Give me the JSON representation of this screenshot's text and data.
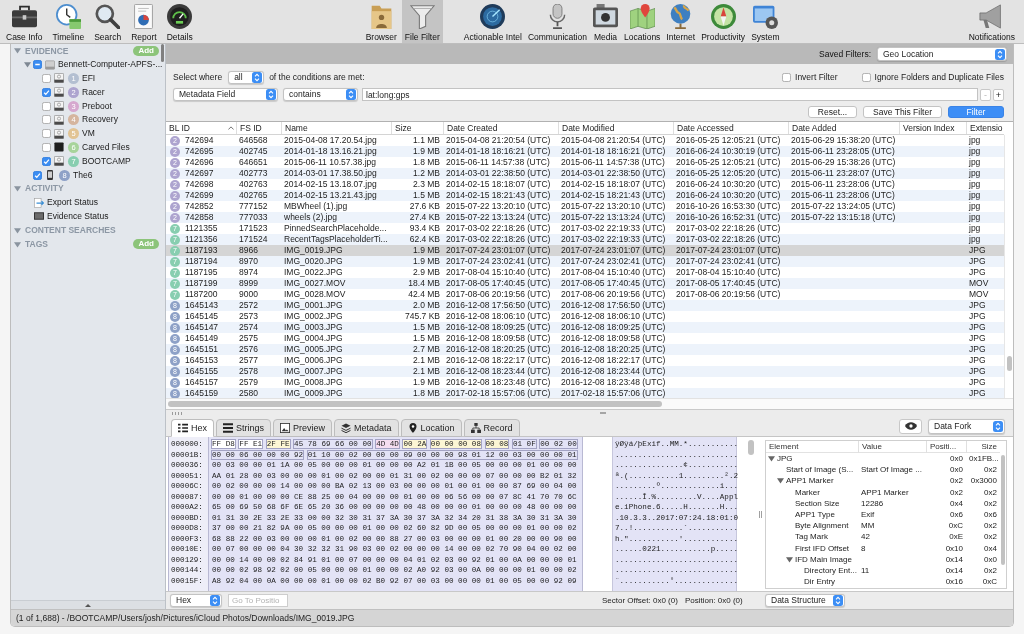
{
  "toolbar": {
    "tools": [
      {
        "label": "Case Info"
      },
      {
        "label": "Timeline"
      },
      {
        "label": "Search"
      },
      {
        "label": "Report"
      },
      {
        "label": "Details"
      }
    ],
    "views": [
      {
        "label": "Browser",
        "selected": false
      },
      {
        "label": "File Filter",
        "selected": true
      }
    ],
    "artifacts": [
      {
        "label": "Actionable Intel"
      },
      {
        "label": "Communication"
      },
      {
        "label": "Media"
      },
      {
        "label": "Locations"
      },
      {
        "label": "Internet"
      },
      {
        "label": "Productivity"
      },
      {
        "label": "System"
      }
    ],
    "notifications": {
      "label": "Notifications"
    }
  },
  "sidebar": {
    "sections": [
      {
        "title": "EVIDENCE",
        "expanded": true,
        "add_button": "Add",
        "items": [
          {
            "label": "Bennett-Computer-APFS-...",
            "kind": "disk",
            "checked": true,
            "mixed": true,
            "expanded": true,
            "children": [
              {
                "label": "EFI",
                "kind": "volume",
                "badge": "1",
                "color": "#b3bfd1",
                "checked": false
              },
              {
                "label": "Racer",
                "kind": "volume",
                "badge": "2",
                "color": "#ada4cf",
                "checked": true
              },
              {
                "label": "Preboot",
                "kind": "volume",
                "badge": "3",
                "color": "#d6a8cf",
                "checked": false
              },
              {
                "label": "Recovery",
                "kind": "volume",
                "badge": "4",
                "color": "#d5b59e",
                "checked": false
              },
              {
                "label": "VM",
                "kind": "volume",
                "badge": "5",
                "color": "#e2c494",
                "checked": false
              },
              {
                "label": "Carved Files",
                "kind": "carved",
                "badge": "6",
                "color": "#a8d49b",
                "checked": false
              },
              {
                "label": "BOOTCAMP",
                "kind": "volume",
                "badge": "7",
                "color": "#88ceb0",
                "checked": true
              }
            ]
          },
          {
            "label": "The6",
            "kind": "phone",
            "badge": "8",
            "color": "#8ea1c7",
            "checked": true,
            "mixed": false
          }
        ]
      },
      {
        "title": "ACTIVITY",
        "expanded": true,
        "items": [
          {
            "label": "Export Status",
            "kind": "export"
          },
          {
            "label": "Evidence Status",
            "kind": "status"
          }
        ]
      },
      {
        "title": "CONTENT SEARCHES",
        "expanded": true
      },
      {
        "title": "TAGS",
        "expanded": true,
        "add_button": "Add"
      }
    ]
  },
  "filter": {
    "saved_label": "Saved Filters:",
    "saved_value": "Geo Location",
    "select_where": "Select where",
    "match": "all",
    "conditions_text": "of the conditions are met:",
    "options": [
      {
        "label": "Invert Filter",
        "checked": false
      },
      {
        "label": "Ignore Folders and Duplicate Files",
        "checked": false
      }
    ],
    "condition": {
      "field": "Metadata Field",
      "operator": "contains",
      "value": "lat:long:gps",
      "remove": {
        "label": "-",
        "disabled": true
      },
      "add": {
        "label": "+",
        "disabled": false
      }
    },
    "buttons": [
      {
        "label": "Reset...",
        "kind": "secondary"
      },
      {
        "label": "Save This Filter",
        "kind": "secondary"
      },
      {
        "label": "Filter",
        "kind": "primary"
      }
    ]
  },
  "table": {
    "columns": [
      {
        "label": "BL ID",
        "sorted": true
      },
      {
        "label": "FS ID",
        "sorted": false
      },
      {
        "label": "Name",
        "sorted": false
      },
      {
        "label": "Size",
        "sorted": false
      },
      {
        "label": "Date Created",
        "sorted": false
      },
      {
        "label": "Date Modified",
        "sorted": false
      },
      {
        "label": "Date Accessed",
        "sorted": false
      },
      {
        "label": "Date Added",
        "sorted": false
      },
      {
        "label": "Version Index",
        "sorted": false
      },
      {
        "label": "Extensio",
        "sorted": false
      }
    ],
    "rows": [
      {
        "badge": "2",
        "color": "#ada4cf",
        "bl_id": "742694",
        "fs_id": "646568",
        "name": "2015-04-08 17.20.54.jpg",
        "size": "1.1 MB",
        "created": "2015-04-08 21:20:54 (UTC)",
        "modified": "2015-04-08 21:20:54 (UTC)",
        "accessed": "2016-05-25 12:05:21 (UTC)",
        "added": "2015-06-29 15:38:20 (UTC)",
        "extension": "jpg",
        "selected": false
      },
      {
        "badge": "2",
        "color": "#ada4cf",
        "bl_id": "742695",
        "fs_id": "402745",
        "name": "2014-01-18 13.16.21.jpg",
        "size": "1.9 MB",
        "created": "2014-01-18 18:16:21 (UTC)",
        "modified": "2014-01-18 18:16:21 (UTC)",
        "accessed": "2016-06-24 10:30:19 (UTC)",
        "added": "2015-06-11 23:28:05 (UTC)",
        "extension": "jpg",
        "selected": false
      },
      {
        "badge": "2",
        "color": "#ada4cf",
        "bl_id": "742696",
        "fs_id": "646651",
        "name": "2015-06-11 10.57.38.jpg",
        "size": "1.8 MB",
        "created": "2015-06-11 14:57:38 (UTC)",
        "modified": "2015-06-11 14:57:38 (UTC)",
        "accessed": "2016-05-25 12:05:21 (UTC)",
        "added": "2015-06-29 15:38:26 (UTC)",
        "extension": "jpg",
        "selected": false
      },
      {
        "badge": "2",
        "color": "#ada4cf",
        "bl_id": "742697",
        "fs_id": "402773",
        "name": "2014-03-01 17.38.50.jpg",
        "size": "1.2 MB",
        "created": "2014-03-01 22:38:50 (UTC)",
        "modified": "2014-03-01 22:38:50 (UTC)",
        "accessed": "2016-05-25 12:05:20 (UTC)",
        "added": "2015-06-11 23:28:07 (UTC)",
        "extension": "jpg",
        "selected": false
      },
      {
        "badge": "2",
        "color": "#ada4cf",
        "bl_id": "742698",
        "fs_id": "402763",
        "name": "2014-02-15 13.18.07.jpg",
        "size": "2.3 MB",
        "created": "2014-02-15 18:18:07 (UTC)",
        "modified": "2014-02-15 18:18:07 (UTC)",
        "accessed": "2016-06-24 10:30:20 (UTC)",
        "added": "2015-06-11 23:28:06 (UTC)",
        "extension": "jpg",
        "selected": false
      },
      {
        "badge": "2",
        "color": "#ada4cf",
        "bl_id": "742699",
        "fs_id": "402765",
        "name": "2014-02-15 13.21.43.jpg",
        "size": "1.5 MB",
        "created": "2014-02-15 18:21:43 (UTC)",
        "modified": "2014-02-15 18:21:43 (UTC)",
        "accessed": "2016-06-24 10:30:20 (UTC)",
        "added": "2015-06-11 23:28:06 (UTC)",
        "extension": "jpg",
        "selected": false
      },
      {
        "badge": "2",
        "color": "#ada4cf",
        "bl_id": "742852",
        "fs_id": "777152",
        "name": "MBWheel (1).jpg",
        "size": "27.6 KB",
        "created": "2015-07-22 13:20:10 (UTC)",
        "modified": "2015-07-22 13:20:10 (UTC)",
        "accessed": "2016-10-26 16:53:30 (UTC)",
        "added": "2015-07-22 13:24:05 (UTC)",
        "extension": "jpg",
        "selected": false
      },
      {
        "badge": "2",
        "color": "#ada4cf",
        "bl_id": "742858",
        "fs_id": "777033",
        "name": "wheels (2).jpg",
        "size": "27.4 KB",
        "created": "2015-07-22 13:13:24 (UTC)",
        "modified": "2015-07-22 13:13:24 (UTC)",
        "accessed": "2016-10-26 16:52:31 (UTC)",
        "added": "2015-07-22 13:15:18 (UTC)",
        "extension": "jpg",
        "selected": false
      },
      {
        "badge": "7",
        "color": "#88ceb0",
        "bl_id": "1121355",
        "fs_id": "171523",
        "name": "PinnedSearchPlaceholde...",
        "size": "93.4 KB",
        "created": "2017-03-02 22:18:26 (UTC)",
        "modified": "2017-03-02 22:19:33 (UTC)",
        "accessed": "2017-03-02 22:18:26 (UTC)",
        "extension": "jpg",
        "selected": false
      },
      {
        "badge": "7",
        "color": "#88ceb0",
        "bl_id": "1121356",
        "fs_id": "171524",
        "name": "RecentTagsPlaceholderTi...",
        "size": "62.4 KB",
        "created": "2017-03-02 22:18:26 (UTC)",
        "modified": "2017-03-02 22:19:33 (UTC)",
        "accessed": "2017-03-02 22:18:26 (UTC)",
        "extension": "jpg",
        "selected": false
      },
      {
        "badge": "7",
        "color": "#88ceb0",
        "bl_id": "1187193",
        "fs_id": "8966",
        "name": "IMG_0019.JPG",
        "size": "1.9 MB",
        "created": "2017-07-24 23:01:07 (UTC)",
        "modified": "2017-07-24 23:01:07 (UTC)",
        "accessed": "2017-07-24 23:01:07 (UTC)",
        "extension": "JPG",
        "selected": true
      },
      {
        "badge": "7",
        "color": "#88ceb0",
        "bl_id": "1187194",
        "fs_id": "8970",
        "name": "IMG_0020.JPG",
        "size": "1.9 MB",
        "created": "2017-07-24 23:02:41 (UTC)",
        "modified": "2017-07-24 23:02:41 (UTC)",
        "accessed": "2017-07-24 23:02:41 (UTC)",
        "extension": "JPG",
        "selected": false
      },
      {
        "badge": "7",
        "color": "#88ceb0",
        "bl_id": "1187195",
        "fs_id": "8974",
        "name": "IMG_0022.JPG",
        "size": "2.9 MB",
        "created": "2017-08-04 15:10:40 (UTC)",
        "modified": "2017-08-04 15:10:40 (UTC)",
        "accessed": "2017-08-04 15:10:40 (UTC)",
        "extension": "JPG",
        "selected": false
      },
      {
        "badge": "7",
        "color": "#88ceb0",
        "bl_id": "1187199",
        "fs_id": "8999",
        "name": "IMG_0027.MOV",
        "size": "18.4 MB",
        "created": "2017-08-05 17:40:45 (UTC)",
        "modified": "2017-08-05 17:40:45 (UTC)",
        "accessed": "2017-08-05 17:40:45 (UTC)",
        "extension": "MOV",
        "selected": false
      },
      {
        "badge": "7",
        "color": "#88ceb0",
        "bl_id": "1187200",
        "fs_id": "9000",
        "name": "IMG_0028.MOV",
        "size": "42.4 MB",
        "created": "2017-08-06 20:19:56 (UTC)",
        "modified": "2017-08-06 20:19:56 (UTC)",
        "accessed": "2017-08-06 20:19:56 (UTC)",
        "extension": "MOV",
        "selected": false
      },
      {
        "badge": "8",
        "color": "#8ea1c7",
        "bl_id": "1645143",
        "fs_id": "2572",
        "name": "IMG_0001.JPG",
        "size": "2.0 MB",
        "created": "2016-12-08 17:56:50 (UTC)",
        "modified": "2016-12-08 17:56:50 (UTC)",
        "extension": "JPG",
        "selected": false
      },
      {
        "badge": "8",
        "color": "#8ea1c7",
        "bl_id": "1645145",
        "fs_id": "2573",
        "name": "IMG_0002.JPG",
        "size": "745.7 KB",
        "created": "2016-12-08 18:06:10 (UTC)",
        "modified": "2016-12-08 18:06:10 (UTC)",
        "extension": "JPG",
        "selected": false
      },
      {
        "badge": "8",
        "color": "#8ea1c7",
        "bl_id": "1645147",
        "fs_id": "2574",
        "name": "IMG_0003.JPG",
        "size": "1.5 MB",
        "created": "2016-12-08 18:09:25 (UTC)",
        "modified": "2016-12-08 18:09:25 (UTC)",
        "extension": "JPG",
        "selected": false
      },
      {
        "badge": "8",
        "color": "#8ea1c7",
        "bl_id": "1645149",
        "fs_id": "2575",
        "name": "IMG_0004.JPG",
        "size": "1.5 MB",
        "created": "2016-12-08 18:09:58 (UTC)",
        "modified": "2016-12-08 18:09:58 (UTC)",
        "extension": "JPG",
        "selected": false
      },
      {
        "badge": "8",
        "color": "#8ea1c7",
        "bl_id": "1645151",
        "fs_id": "2576",
        "name": "IMG_0005.JPG",
        "size": "2.7 MB",
        "created": "2016-12-08 18:20:25 (UTC)",
        "modified": "2016-12-08 18:20:25 (UTC)",
        "extension": "JPG",
        "selected": false
      },
      {
        "badge": "8",
        "color": "#8ea1c7",
        "bl_id": "1645153",
        "fs_id": "2577",
        "name": "IMG_0006.JPG",
        "size": "2.1 MB",
        "created": "2016-12-08 18:22:17 (UTC)",
        "modified": "2016-12-08 18:22:17 (UTC)",
        "extension": "JPG",
        "selected": false
      },
      {
        "badge": "8",
        "color": "#8ea1c7",
        "bl_id": "1645155",
        "fs_id": "2578",
        "name": "IMG_0007.JPG",
        "size": "2.1 MB",
        "created": "2016-12-08 18:23:44 (UTC)",
        "modified": "2016-12-08 18:23:44 (UTC)",
        "extension": "JPG",
        "selected": false
      },
      {
        "badge": "8",
        "color": "#8ea1c7",
        "bl_id": "1645157",
        "fs_id": "2579",
        "name": "IMG_0008.JPG",
        "size": "1.9 MB",
        "created": "2016-12-08 18:23:48 (UTC)",
        "modified": "2016-12-08 18:23:48 (UTC)",
        "extension": "JPG",
        "selected": false
      },
      {
        "badge": "8",
        "color": "#8ea1c7",
        "bl_id": "1645159",
        "fs_id": "2580",
        "name": "IMG_0009.JPG",
        "size": "1.8 MB",
        "created": "2017-02-18 15:57:06 (UTC)",
        "modified": "2017-02-18 15:57:06 (UTC)",
        "extension": "JPG",
        "selected": false
      }
    ]
  },
  "inspector": {
    "tabs": [
      {
        "label": "Hex",
        "selected": true
      },
      {
        "label": "Strings",
        "selected": false
      },
      {
        "label": "Preview",
        "selected": false
      },
      {
        "label": "Metadata",
        "selected": false
      },
      {
        "label": "Location",
        "selected": false
      },
      {
        "label": "Record",
        "selected": false
      }
    ],
    "fork": "Data Fork",
    "hex": {
      "rows": [
        {
          "offset": "000000:",
          "groups": [
            {
              "bytes": "FF D8",
              "color": "#ffffff"
            },
            {
              "bytes": "FF E1",
              "color": "#ffffff"
            },
            {
              "bytes": "2F FE",
              "color": "#fcf6d4"
            },
            {
              "bytes": "45 78 69 66 00 00"
            },
            {
              "bytes": "4D 4D",
              "color": "#f5ddf0"
            },
            {
              "bytes": "00 2A",
              "color": "#fcf6d4"
            },
            {
              "bytes": "00 00 00 08",
              "color": "#fcf6d4"
            },
            {
              "bytes": "00 08",
              "color": "#fcf6d4"
            },
            {
              "bytes": "01 0F"
            },
            {
              "bytes": "00 02 00"
            }
          ],
          "ascii": "ÿØÿá/þExif..MM.*..........."
        },
        {
          "offset": "00001B:",
          "groups": [
            {
              "bytes": "00 00 06 00 00 00 92"
            },
            {
              "bytes": "01 10 00 02 00 00 00 09 00 00 00 98 01 12 00 03 00 00 00 01"
            }
          ],
          "ascii": "..........................."
        },
        {
          "offset": "000036:",
          "bytes": "00 03 00 00 01 1A 00 05 00 00 00 01 00 00 00 A2 01 1B 00 05 00 00 00 01 00 00 00",
          "ascii": "...............¢..........."
        },
        {
          "offset": "000051:",
          "bytes": "AA 01 28 00 03 00 00 00 01 00 02 00 00 01 31 00 02 00 00 00 07 00 00 00 B2 01 32",
          "ascii": "ª.(...........1.........².2"
        },
        {
          "offset": "00006C:",
          "bytes": "00 02 00 00 00 14 00 00 00 BA 02 13 00 03 00 00 00 01 00 01 00 00 87 69 00 04 00",
          "ascii": ".........º.............i..."
        },
        {
          "offset": "000087:",
          "bytes": "00 00 01 00 00 00 CE 88 25 00 04 00 00 00 01 00 00 06 56 00 00 07 8C 41 70 70 6C",
          "ascii": "......Î.%.........V....Appl"
        },
        {
          "offset": "0000A2:",
          "bytes": "65 00 69 50 68 6F 6E 65 20 36 00 00 00 00 00 48 00 00 00 01 00 00 00 48 00 00 00",
          "ascii": "e.iPhone.6.....H.......H..."
        },
        {
          "offset": "0000BD:",
          "bytes": "01 31 30 2E 33 2E 33 00 00 32 30 31 37 3A 30 37 3A 32 34 20 31 38 3A 30 31 3A 30",
          "ascii": ".10.3.3..2017:07:24.18:01:0"
        },
        {
          "offset": "0000D8:",
          "bytes": "37 00 00 21 82 9A 00 05 00 00 00 01 00 00 02 60 82 9D 00 05 00 00 00 01 00 00 02",
          "ascii": "7..!...........`..........."
        },
        {
          "offset": "0000F3:",
          "bytes": "68 88 22 00 03 00 00 00 01 00 02 00 00 88 27 00 03 00 00 00 01 00 20 00 00 90 00",
          "ascii": "h.\"...........'............"
        },
        {
          "offset": "00010E:",
          "bytes": "00 07 00 00 00 04 30 32 32 31 90 03 00 02 00 00 00 14 00 00 02 70 90 04 00 02 00",
          "ascii": "......0221...........p....."
        },
        {
          "offset": "000129:",
          "bytes": "00 00 14 00 00 02 84 91 01 00 07 00 00 00 04 01 02 03 00 92 01 00 0A 00 00 00 01",
          "ascii": "..........................."
        },
        {
          "offset": "000144:",
          "bytes": "00 00 02 98 92 02 00 05 00 00 00 01 00 00 02 A0 92 03 00 0A 00 00 00 01 00 00 02",
          "ascii": "..........................."
        },
        {
          "offset": "00015F:",
          "bytes": "A8 92 04 00 0A 00 00 00 01 00 00 02 B0 92 07 00 03 00 00 00 01 00 05 00 00 92 09",
          "ascii": "¨...........°.............."
        }
      ]
    },
    "mode": "Hex",
    "goto_placeholder": "Go To Positio",
    "sector_offset": "Sector Offset: 0x0 (0)",
    "position": "Position: 0x0 (0)",
    "structure": {
      "columns": [
        "Element",
        "Value",
        "Positi...",
        "Size"
      ],
      "rows": [
        {
          "element": "JPG",
          "position": "0x0",
          "size": "0x1FB...",
          "expanded": true,
          "children": [
            {
              "element": "Start of Image (S...",
              "value": "Start Of Image ...",
              "position": "0x0",
              "size": "0x2"
            },
            {
              "element": "APP1 Marker",
              "position": "0x2",
              "size": "0x3000",
              "expanded": true,
              "children": [
                {
                  "element": "Marker",
                  "value": "APP1 Marker",
                  "position": "0x2",
                  "size": "0x2"
                },
                {
                  "element": "Section Size",
                  "value": "12286",
                  "position": "0x4",
                  "size": "0x2"
                },
                {
                  "element": "APP1 Type",
                  "value": "Exif",
                  "position": "0x6",
                  "size": "0x6"
                },
                {
                  "element": "Byte Alignment",
                  "value": "MM",
                  "position": "0xC",
                  "size": "0x2"
                },
                {
                  "element": "Tag Mark",
                  "value": "42",
                  "position": "0xE",
                  "size": "0x2"
                },
                {
                  "element": "First IFD Offset",
                  "value": "8",
                  "position": "0x10",
                  "size": "0x4"
                },
                {
                  "element": "IFD Main Image",
                  "position": "0x14",
                  "size": "0x0",
                  "expanded": true,
                  "children": [
                    {
                      "element": "Directory Ent...",
                      "value": "11",
                      "position": "0x14",
                      "size": "0x2"
                    },
                    {
                      "element": "Dir Entry",
                      "position": "0x16",
                      "size": "0xC"
                    }
                  ]
                }
              ]
            }
          ]
        }
      ]
    },
    "structure_mode": "Data Structure"
  },
  "status_bar": {
    "text": "(1 of 1,688) - /BOOTCAMP/Users/josh/Pictures/iCloud Photos/Downloads/IMG_0019.JPG"
  }
}
